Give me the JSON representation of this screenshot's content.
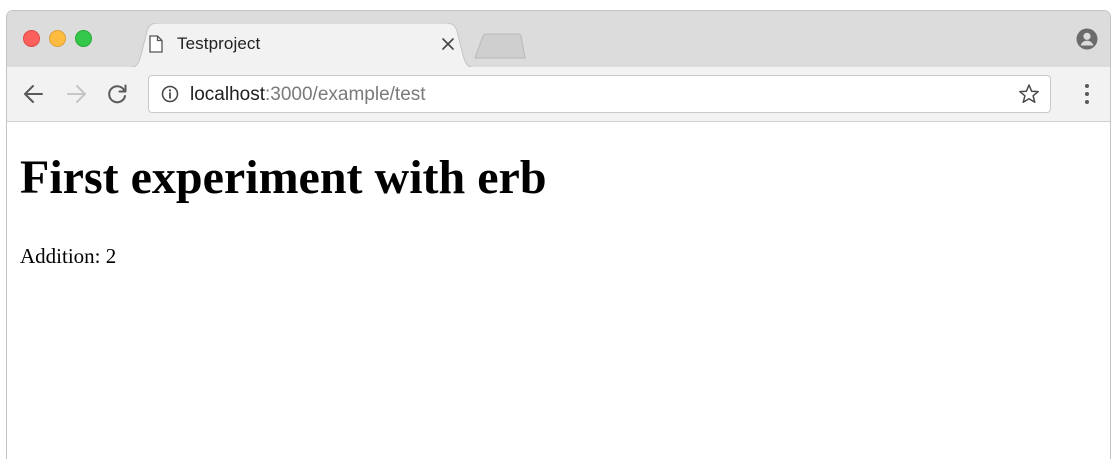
{
  "browser": {
    "tab": {
      "title": "Testproject"
    },
    "address_bar": {
      "host": "localhost",
      "rest": ":3000/example/test"
    },
    "icons": {
      "tab_page": "page-icon",
      "tab_close": "close-icon",
      "back": "arrow-left-icon",
      "forward": "arrow-right-icon",
      "reload": "reload-icon",
      "info": "info-icon",
      "bookmark": "star-icon",
      "menu": "kebab-menu-icon",
      "profile": "profile-icon"
    },
    "colors": {
      "close": "#fc605c",
      "minimize": "#fdbc40",
      "maximize": "#34c84a",
      "titlebar": "#dcdcdc",
      "toolbar": "#f2f2f2"
    }
  },
  "page": {
    "heading": "First experiment with erb",
    "addition_text": "Addition: 2"
  }
}
